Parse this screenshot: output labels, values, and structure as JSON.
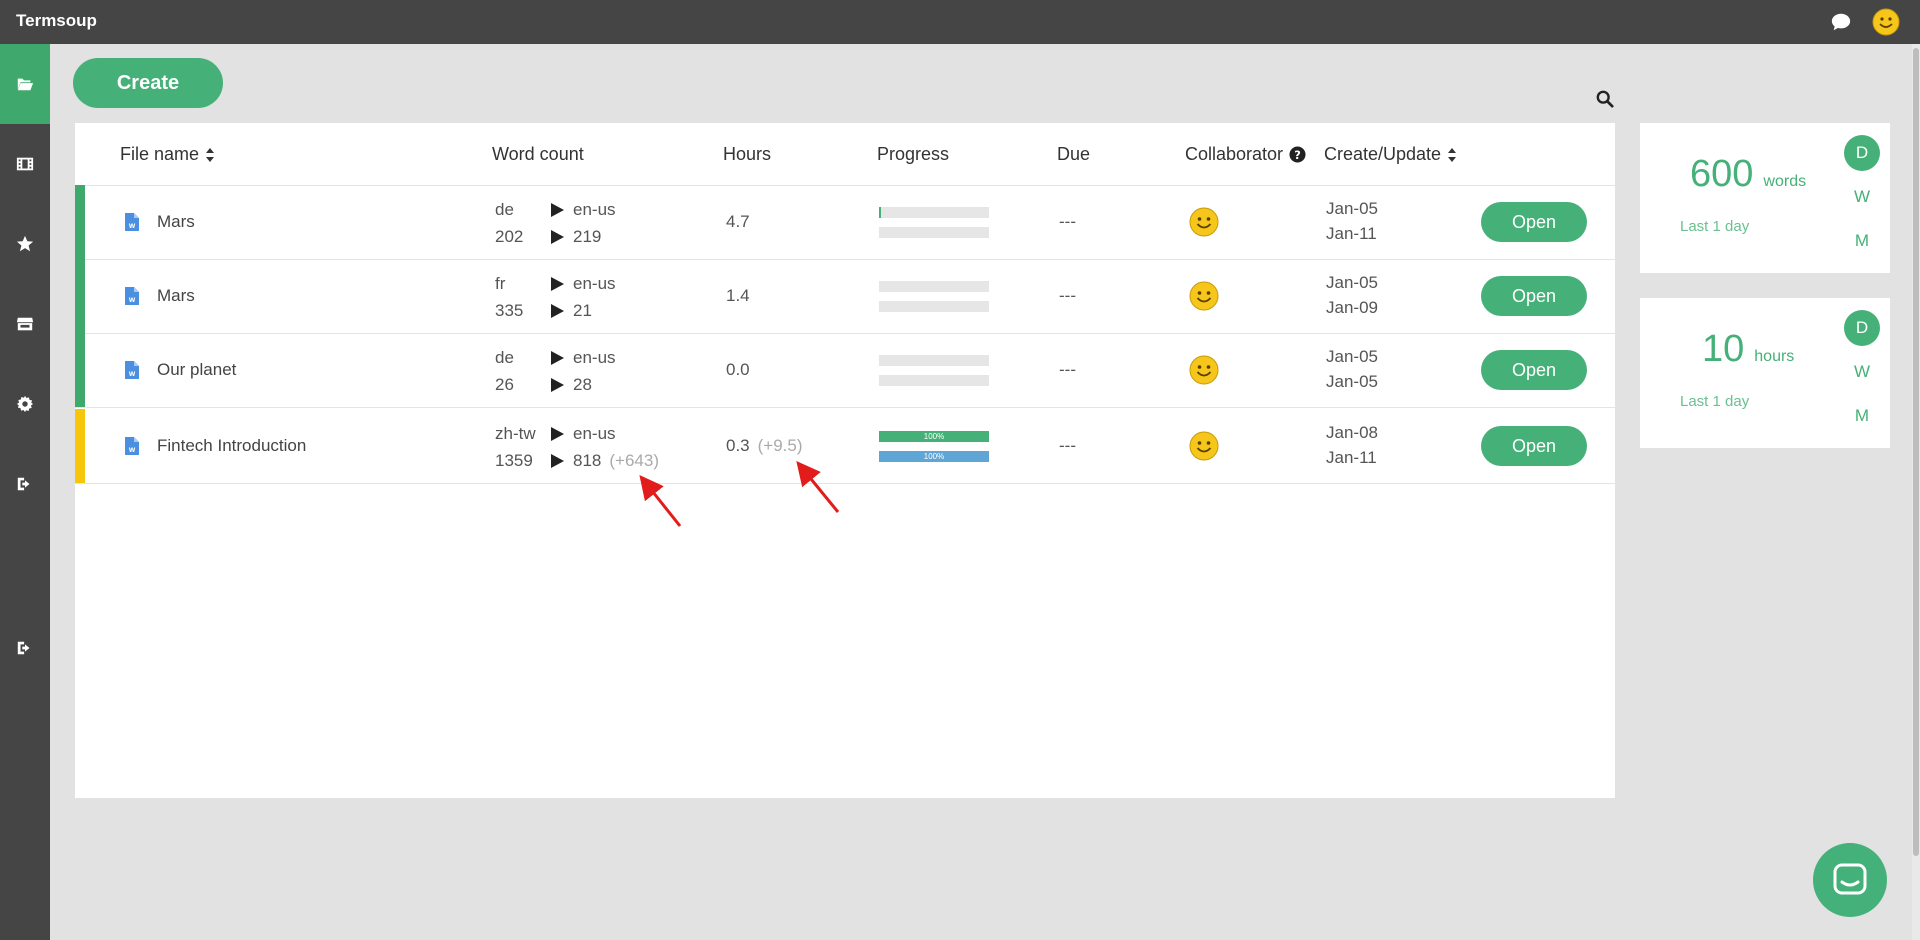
{
  "app": {
    "title": "Termsoup"
  },
  "toolbar": {
    "create_label": "Create"
  },
  "table": {
    "headers": {
      "file_name": "File  name",
      "word_count": "Word  count",
      "hours": "Hours",
      "progress": "Progress",
      "due": "Due",
      "collaborator": "Collaborator",
      "create_update": "Create/Update"
    },
    "rows": [
      {
        "bar_color": "#3fa96d",
        "name": "Mars",
        "src_lang": "de",
        "src_count": "202",
        "tgt_lang": "en-us",
        "tgt_count": "219",
        "tgt_delta": "",
        "hours": "4.7",
        "hours_delta": "",
        "progress1": 2,
        "progress2": 0,
        "progress1_label": "",
        "progress2_label": "",
        "due": "---",
        "created": "Jan-05",
        "updated": "Jan-11",
        "open_label": "Open"
      },
      {
        "bar_color": "#3fa96d",
        "name": "Mars",
        "src_lang": "fr",
        "src_count": "335",
        "tgt_lang": "en-us",
        "tgt_count": "21",
        "tgt_delta": "",
        "hours": "1.4",
        "hours_delta": "",
        "progress1": 0,
        "progress2": 0,
        "progress1_label": "",
        "progress2_label": "",
        "due": "---",
        "created": "Jan-05",
        "updated": "Jan-09",
        "open_label": "Open"
      },
      {
        "bar_color": "#3fa96d",
        "name": "Our  planet",
        "src_lang": "de",
        "src_count": "26",
        "tgt_lang": "en-us",
        "tgt_count": "28",
        "tgt_delta": "",
        "hours": "0.0",
        "hours_delta": "",
        "progress1": 0,
        "progress2": 0,
        "progress1_label": "",
        "progress2_label": "",
        "due": "---",
        "created": "Jan-05",
        "updated": "Jan-05",
        "open_label": "Open"
      },
      {
        "bar_color": "#f5c60c",
        "name": "Fintech Introduction",
        "src_lang": "zh-tw",
        "src_count": "1359",
        "tgt_lang": "en-us",
        "tgt_count": "818",
        "tgt_delta": "(+643)",
        "hours": "0.3",
        "hours_delta": "(+9.5)",
        "progress1": 100,
        "progress2": 100,
        "progress1_label": "100%",
        "progress2_label": "100%",
        "due": "---",
        "created": "Jan-08",
        "updated": "Jan-11",
        "open_label": "Open"
      }
    ]
  },
  "stats": [
    {
      "value": "600",
      "unit": "words",
      "period": "Last  1  day",
      "options": [
        "D",
        "W",
        "M"
      ]
    },
    {
      "value": "10",
      "unit": "hours",
      "period": "Last  1  day",
      "options": [
        "D",
        "W",
        "M"
      ]
    }
  ],
  "colors": {
    "accent": "#46b079",
    "sidebar": "#454545",
    "progress_primary": "#46b079",
    "progress_secondary": "#5fa6d6",
    "row_warning": "#f5c60c"
  },
  "icons": {
    "sidebar": [
      "folder-open-icon",
      "film-icon",
      "star-icon",
      "store-icon",
      "gear-icon",
      "sign-out-icon",
      "sign-out-icon"
    ]
  }
}
